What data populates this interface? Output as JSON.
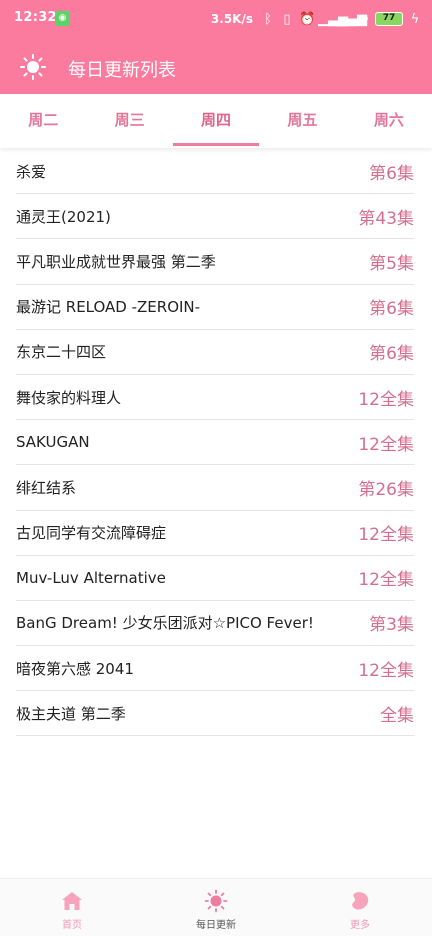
{
  "status": {
    "time": "12:32",
    "speed": "3.5K/s",
    "battery": "77"
  },
  "header": {
    "title": "每日更新列表"
  },
  "tabs": [
    {
      "label": "周二",
      "active": false
    },
    {
      "label": "周三",
      "active": false
    },
    {
      "label": "周四",
      "active": true
    },
    {
      "label": "周五",
      "active": false
    },
    {
      "label": "周六",
      "active": false
    }
  ],
  "shows": [
    {
      "name": "杀爱",
      "episode": "第6集"
    },
    {
      "name": "通灵王(2021)",
      "episode": "第43集"
    },
    {
      "name": "平凡职业成就世界最强 第二季",
      "episode": "第5集"
    },
    {
      "name": "最游记 RELOAD -ZEROIN-",
      "episode": "第6集"
    },
    {
      "name": "东京二十四区",
      "episode": "第6集"
    },
    {
      "name": "舞伎家的料理人",
      "episode": "12全集"
    },
    {
      "name": "SAKUGAN",
      "episode": "12全集"
    },
    {
      "name": "绯红结系",
      "episode": "第26集"
    },
    {
      "name": "古见同学有交流障碍症",
      "episode": "12全集"
    },
    {
      "name": "Muv-Luv Alternative",
      "episode": "12全集"
    },
    {
      "name": "BanG Dream! 少女乐团派对☆PICO Fever!",
      "episode": "第3集"
    },
    {
      "name": "暗夜第六感 2041",
      "episode": "12全集"
    },
    {
      "name": "极主夫道 第二季",
      "episode": "全集"
    }
  ],
  "bottom_nav": [
    {
      "label": "首页",
      "icon": "home-icon"
    },
    {
      "label": "每日更新",
      "icon": "sun-icon"
    },
    {
      "label": "更多",
      "icon": "bean-icon"
    }
  ],
  "colors": {
    "accent": "#fb7b9f",
    "episode_text": "#d46f8f",
    "tab_text": "#e37699"
  }
}
